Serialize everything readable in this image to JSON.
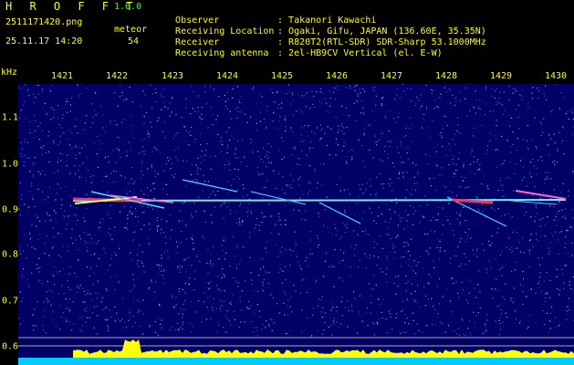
{
  "header": {
    "app_title": "H R O F F T",
    "app_version": "1.0.0",
    "file_name": "2511171420.png",
    "datetime": "25.11.17 14:20",
    "class_label": "meteor",
    "count": "54"
  },
  "station": {
    "observer_label": "Observer",
    "observer_value": "Takanori Kawachi",
    "location_label": "Receiving Location",
    "location_value": "Ogaki, Gifu, JAPAN (136.60E, 35.35N)",
    "receiver_label": "Receiver",
    "receiver_value": "R820T2(RTL-SDR) SDR-Sharp 53.1000MHz",
    "antenna_label": "Receiving antenna",
    "antenna_value": "2el-HB9CV Vertical (el. E-W)",
    "separator": ":"
  },
  "plot": {
    "unit_label": "kHz",
    "x_ticks": [
      "1421",
      "1422",
      "1423",
      "1424",
      "1425",
      "1426",
      "1427",
      "1428",
      "1429",
      "1430"
    ],
    "y_ticks": [
      "1.1",
      "1.0",
      "0.9",
      "0.8",
      "0.7",
      "0.6"
    ],
    "colors": {
      "background": "#000066",
      "label": "#ffff00",
      "trace": "#55eeff",
      "power": "#ffff00",
      "baseline": "#00ccff"
    }
  }
}
